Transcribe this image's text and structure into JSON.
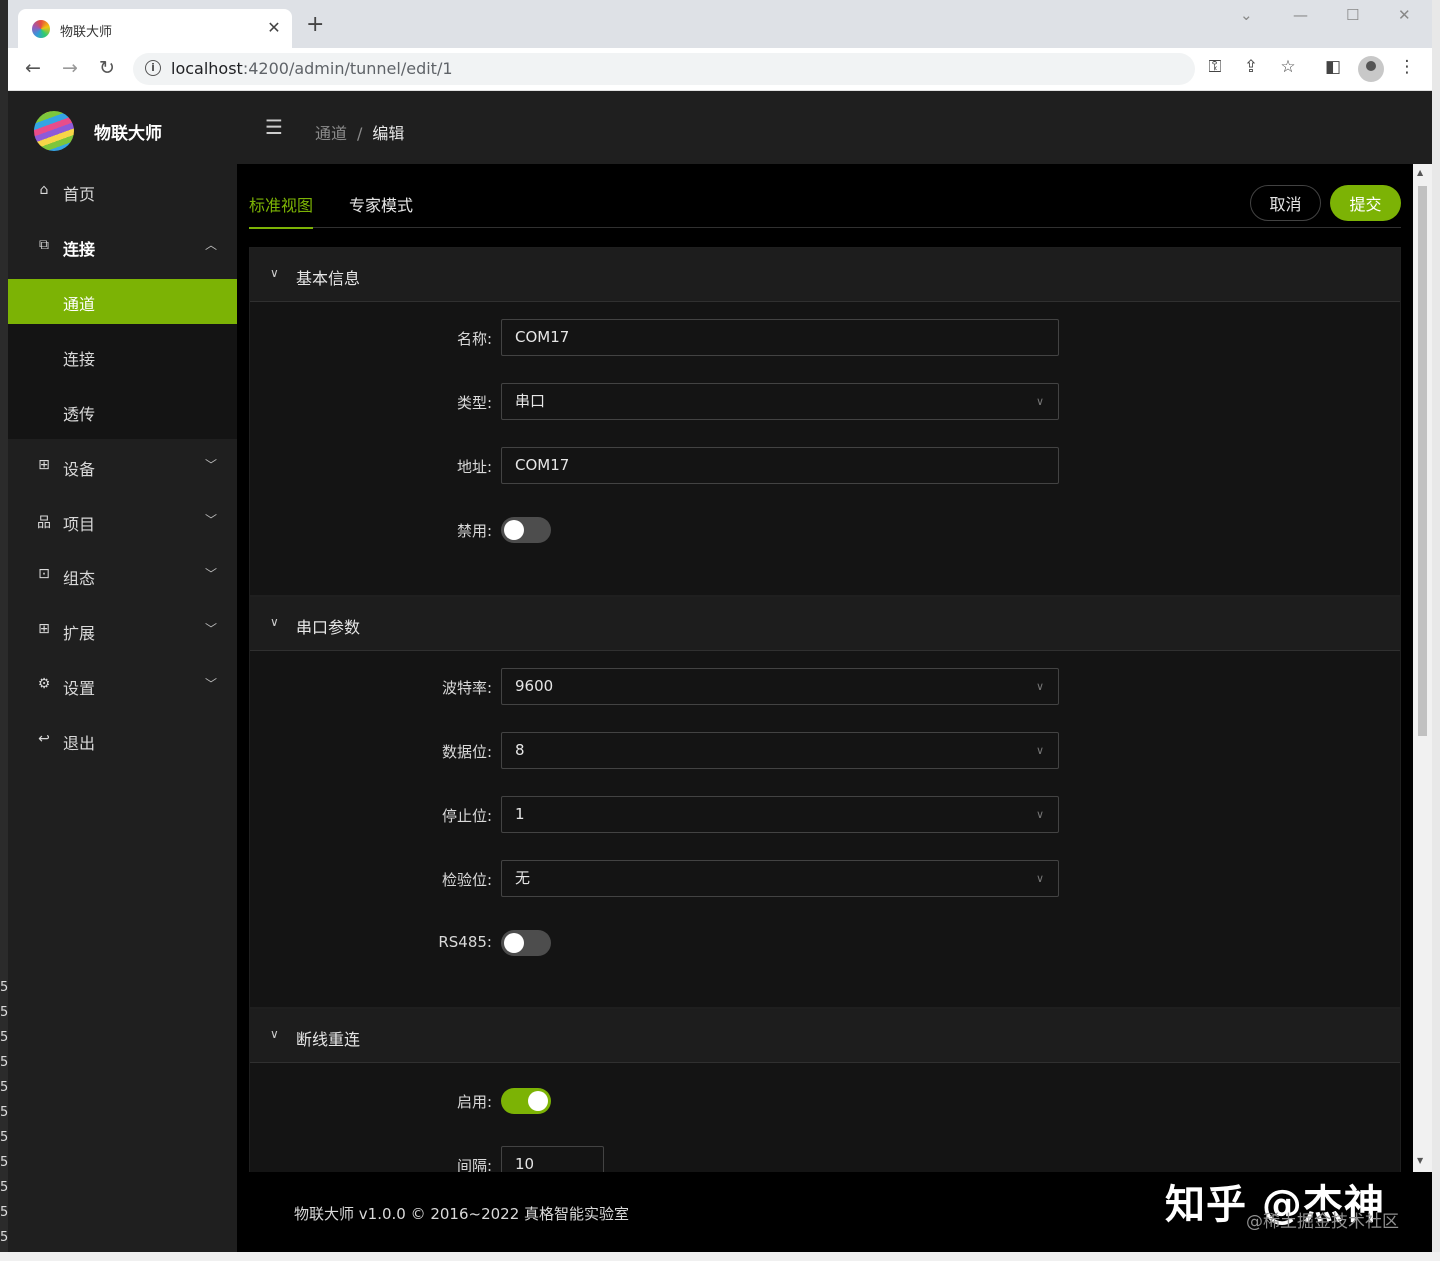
{
  "browser": {
    "tab_title": "物联大师",
    "url_host": "localhost",
    "url_rest": ":4200/admin/tunnel/edit/1"
  },
  "desktop": {
    "line_numbers": [
      "5",
      "5",
      "5",
      "5",
      "5",
      "5",
      "5",
      "5",
      "5",
      "5",
      "5"
    ]
  },
  "app": {
    "brand": "物联大师",
    "accent_color": "#7cb305"
  },
  "sidebar": {
    "items": [
      {
        "label": "首页",
        "icon": "home-icon"
      },
      {
        "label": "连接",
        "icon": "link-icon",
        "expanded": true
      },
      {
        "label": "设备",
        "icon": "device-icon"
      },
      {
        "label": "项目",
        "icon": "project-icon"
      },
      {
        "label": "组态",
        "icon": "layout-icon"
      },
      {
        "label": "扩展",
        "icon": "extension-icon"
      },
      {
        "label": "设置",
        "icon": "gear-icon"
      },
      {
        "label": "退出",
        "icon": "logout-icon"
      }
    ],
    "submenu": [
      {
        "label": "通道",
        "active": true
      },
      {
        "label": "连接"
      },
      {
        "label": "透传"
      }
    ]
  },
  "header": {
    "breadcrumb": [
      "通道",
      "编辑"
    ]
  },
  "tabs": {
    "standard": "标准视图",
    "expert": "专家模式"
  },
  "actions": {
    "cancel": "取消",
    "submit": "提交"
  },
  "sections": {
    "basic": {
      "title": "基本信息",
      "name_label": "名称:",
      "name_value": "COM17",
      "type_label": "类型:",
      "type_value": "串口",
      "addr_label": "地址:",
      "addr_value": "COM17",
      "disabled_label": "禁用:",
      "disabled_on": false
    },
    "serial": {
      "title": "串口参数",
      "baud_label": "波特率:",
      "baud_value": "9600",
      "databits_label": "数据位:",
      "databits_value": "8",
      "stopbits_label": "停止位:",
      "stopbits_value": "1",
      "parity_label": "检验位:",
      "parity_value": "无",
      "rs485_label": "RS485:",
      "rs485_on": false
    },
    "reconnect": {
      "title": "断线重连",
      "enable_label": "启用:",
      "enable_on": true,
      "interval_label": "间隔:",
      "interval_value": "10"
    }
  },
  "footer": {
    "text": "物联大师 v1.0.0 © 2016~2022 真格智能实验室"
  },
  "watermark": {
    "main": "知乎 @杰神",
    "sub": "@稀土掘金技术社区"
  }
}
